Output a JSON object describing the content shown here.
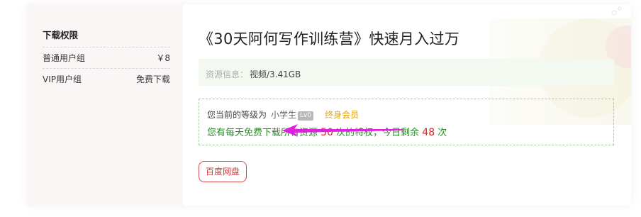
{
  "sidebar": {
    "title": "下载权限",
    "rows": [
      {
        "group": "普通用户组",
        "value": "￥8"
      },
      {
        "group": "VIP用户组",
        "value": "免费下载"
      }
    ]
  },
  "main": {
    "title": "《30天阿何写作训练营》快速月入过万",
    "resource": {
      "label": "资源信息：",
      "value": "视频/3.41GB"
    },
    "notice": {
      "level_prefix": "您当前的等级为",
      "level_name": "小学生",
      "level_badge": "Lv0",
      "vip": "终身会员",
      "line2_a": "您有每天免费下载所有资源",
      "quota": "50",
      "line2_b": "次的特权，今日剩余",
      "remaining": "48",
      "line2_c": "次"
    },
    "download_button": "百度网盘"
  },
  "colors": {
    "accent_red": "#e02020",
    "green_text": "#2a8a2a",
    "vip_gold": "#e6a200",
    "arrow_magenta": "#e020e0"
  }
}
